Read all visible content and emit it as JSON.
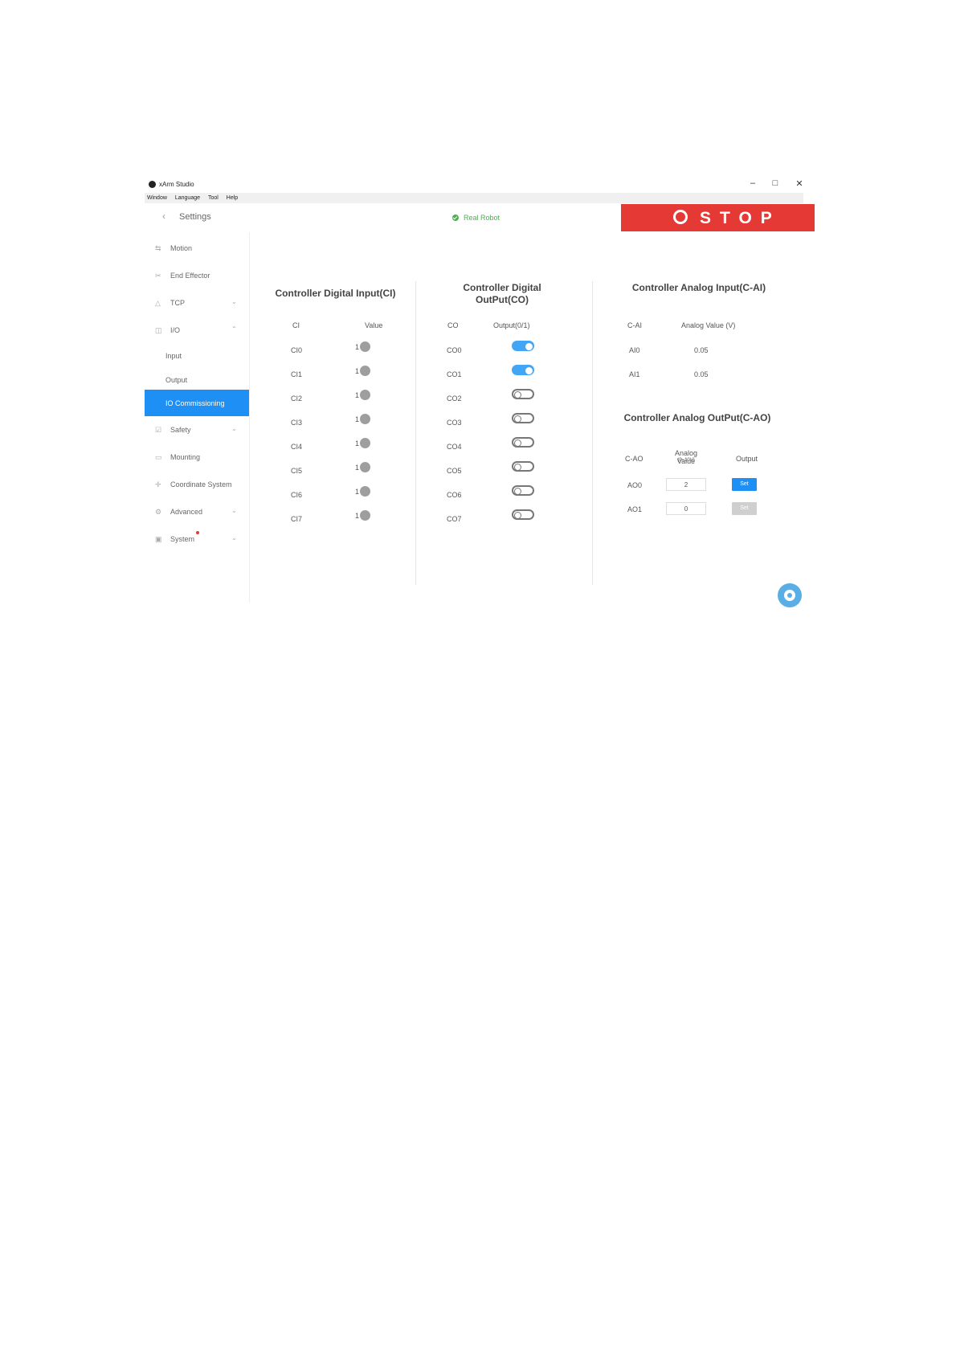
{
  "window": {
    "app_name": "xArm Studio",
    "controls": {
      "minimize": "–",
      "maximize": "□",
      "close": "✕"
    },
    "menu": [
      "Window",
      "Language",
      "Tool",
      "Help"
    ]
  },
  "header": {
    "back_icon": "‹",
    "title": "Settings",
    "status": "Real Robot",
    "status_color": "#4caf50",
    "stop_label": "STOP",
    "stop_color": "#e53935"
  },
  "sidebar": {
    "items": [
      {
        "label": "Motion",
        "icon": "motion-icon",
        "glyph": "⇆",
        "chevron": ""
      },
      {
        "label": "End Effector",
        "icon": "end-effector-icon",
        "glyph": "✂",
        "chevron": ""
      },
      {
        "label": "TCP",
        "icon": "tcp-icon",
        "glyph": "△",
        "chevron": "⌄"
      },
      {
        "label": "I/O",
        "icon": "io-icon",
        "glyph": "◫",
        "chevron": "⌃"
      },
      {
        "label": "Input",
        "icon": "",
        "glyph": "",
        "chevron": ""
      },
      {
        "label": "Output",
        "icon": "",
        "glyph": "",
        "chevron": ""
      },
      {
        "label": "IO Commissioning",
        "icon": "",
        "glyph": "",
        "chevron": ""
      },
      {
        "label": "Safety",
        "icon": "safety-icon",
        "glyph": "☑",
        "chevron": "⌄"
      },
      {
        "label": "Mounting",
        "icon": "mounting-icon",
        "glyph": "▭",
        "chevron": ""
      },
      {
        "label": "Coordinate System",
        "icon": "coordinate-icon",
        "glyph": "✛",
        "chevron": ""
      },
      {
        "label": "Advanced",
        "icon": "advanced-icon",
        "glyph": "⚙",
        "chevron": "⌄"
      },
      {
        "label": "System",
        "icon": "system-icon",
        "glyph": "▣",
        "chevron": "⌄"
      }
    ],
    "active": "IO Commissioning",
    "accent": "#1e8ff5"
  },
  "ci": {
    "title": "Controller Digital Input(CI)",
    "col1": "CI",
    "col2": "Value",
    "rows": [
      {
        "name": "CI0",
        "value": "1"
      },
      {
        "name": "CI1",
        "value": "1"
      },
      {
        "name": "CI2",
        "value": "1"
      },
      {
        "name": "CI3",
        "value": "1"
      },
      {
        "name": "CI4",
        "value": "1"
      },
      {
        "name": "CI5",
        "value": "1"
      },
      {
        "name": "CI6",
        "value": "1"
      },
      {
        "name": "CI7",
        "value": "1"
      }
    ]
  },
  "co": {
    "title": "Controller Digital OutPut(CO)",
    "col1": "CO",
    "col2": "Output(0/1)",
    "rows": [
      {
        "name": "CO0",
        "on": true
      },
      {
        "name": "CO1",
        "on": true
      },
      {
        "name": "CO2",
        "on": false
      },
      {
        "name": "CO3",
        "on": false
      },
      {
        "name": "CO4",
        "on": false
      },
      {
        "name": "CO5",
        "on": false
      },
      {
        "name": "CO6",
        "on": false
      },
      {
        "name": "CO7",
        "on": false
      }
    ]
  },
  "ai": {
    "title": "Controller Analog Input(C-AI)",
    "col1": "C-AI",
    "col2": "Analog Value (V)",
    "rows": [
      {
        "name": "AI0",
        "value": "0.05"
      },
      {
        "name": "AI1",
        "value": "0.05"
      }
    ]
  },
  "ao": {
    "title": "Controller Analog OutPut(C-AO)",
    "col1": "C-AO",
    "col2": "Analog Value",
    "col2_sub": "(0~10V)",
    "col3": "Output",
    "rows": [
      {
        "name": "AO0",
        "value": "2",
        "button": "Set",
        "enabled": true
      },
      {
        "name": "AO1",
        "value": "0",
        "button": "Set",
        "enabled": false
      }
    ]
  },
  "fab_icon": "gear-icon"
}
